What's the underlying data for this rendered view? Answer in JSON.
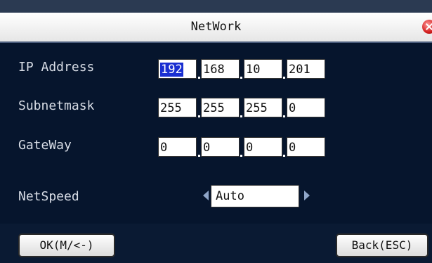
{
  "window": {
    "title": "NetWork"
  },
  "fields": {
    "ip_address": {
      "label": "IP Address",
      "octets": [
        "192",
        "168",
        "10",
        "201"
      ]
    },
    "subnetmask": {
      "label": "Subnetmask",
      "octets": [
        "255",
        "255",
        "255",
        "0"
      ]
    },
    "gateway": {
      "label": "GateWay",
      "octets": [
        "0",
        "0",
        "0",
        "0"
      ]
    },
    "netspeed": {
      "label": "NetSpeed",
      "value": "Auto"
    }
  },
  "buttons": {
    "ok": "OK(M/<-)",
    "back": "Back(ESC)"
  },
  "colors": {
    "background": "#06152d",
    "selection": "#1a2fd1",
    "close": "#d42020"
  },
  "icons": {
    "close": "close-icon",
    "prev": "arrow-left-icon",
    "next": "arrow-right-icon"
  }
}
